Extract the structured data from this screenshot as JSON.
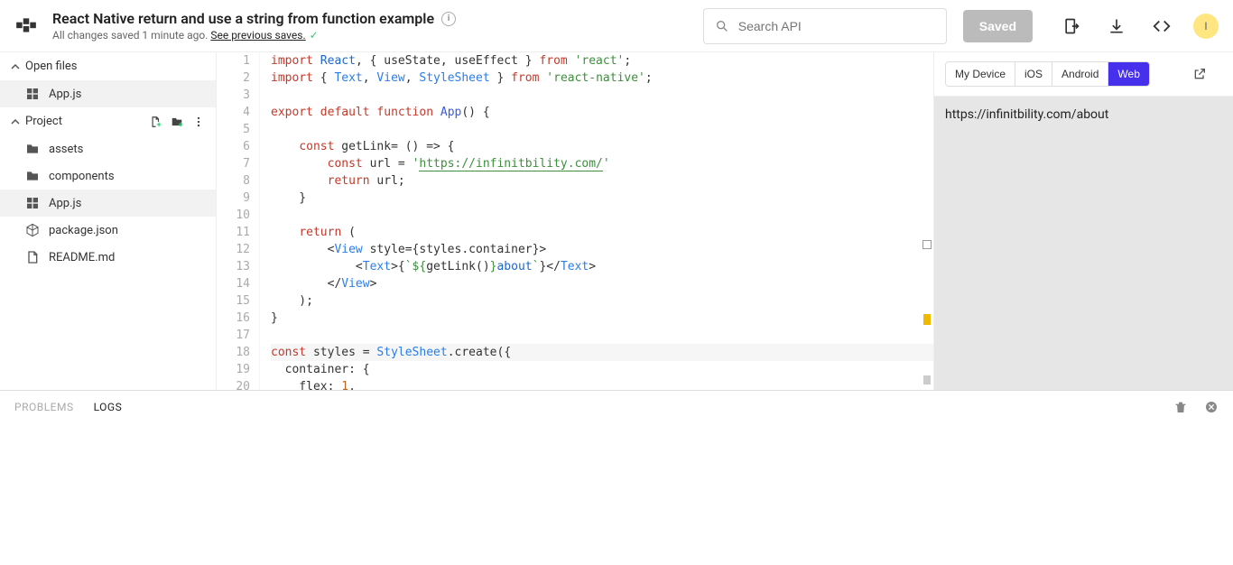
{
  "header": {
    "title": "React Native return and use a string from function example",
    "subtitle_prefix": "All changes saved 1 minute ago. ",
    "subtitle_link": "See previous saves.",
    "search_placeholder": "Search API",
    "saved_label": "Saved",
    "avatar_letter": "I"
  },
  "sidebar": {
    "open_files_label": "Open files",
    "open_files": [
      {
        "name": "App.js",
        "icon": "js-icon"
      }
    ],
    "project_label": "Project",
    "project_items": [
      {
        "name": "assets",
        "icon": "folder-icon"
      },
      {
        "name": "components",
        "icon": "folder-icon"
      },
      {
        "name": "App.js",
        "icon": "js-icon",
        "active": true
      },
      {
        "name": "package.json",
        "icon": "package-icon"
      },
      {
        "name": "README.md",
        "icon": "md-icon"
      }
    ]
  },
  "editor": {
    "line_count": 20,
    "lines": [
      {
        "n": 1,
        "html": "<span class='tok-kw'>import</span> <span class='tok-def'>React</span>, { useState, useEffect } <span class='tok-kw'>from</span> <span class='tok-str'>'react'</span>;"
      },
      {
        "n": 2,
        "html": "<span class='tok-kw'>import</span> { <span class='tok-cls'>Text</span>, <span class='tok-cls'>View</span>, <span class='tok-cls'>StyleSheet</span> } <span class='tok-kw'>from</span> <span class='tok-str'>'react-native'</span>;"
      },
      {
        "n": 3,
        "html": ""
      },
      {
        "n": 4,
        "html": "<span class='tok-kw'>export</span> <span class='tok-kw'>default</span> <span class='tok-kw'>function</span> <span class='tok-fn'>App</span>() {"
      },
      {
        "n": 5,
        "html": ""
      },
      {
        "n": 6,
        "html": "    <span class='tok-kw'>const</span> getLink= () => {"
      },
      {
        "n": 7,
        "html": "        <span class='tok-kw'>const</span> url = <span class='tok-str'>'</span><span class='tok-url'>https://infinitbility.com/</span><span class='tok-str'>'</span>"
      },
      {
        "n": 8,
        "html": "        <span class='tok-kw'>return</span> url;"
      },
      {
        "n": 9,
        "html": "    }"
      },
      {
        "n": 10,
        "html": ""
      },
      {
        "n": 11,
        "html": "    <span class='tok-kw'>return</span> ("
      },
      {
        "n": 12,
        "html": "        &lt;<span class='tok-cls'>View</span> style={styles.container}&gt;"
      },
      {
        "n": 13,
        "html": "            &lt;<span class='tok-cls'>Text</span>&gt;{<span class='tok-str'>`${</span>getLink()<span class='tok-str'>}</span><span class='tok-def'>about</span><span class='tok-str'>`</span>}&lt;/<span class='tok-cls'>Text</span>&gt;"
      },
      {
        "n": 14,
        "html": "        &lt;/<span class='tok-cls'>View</span>&gt;"
      },
      {
        "n": 15,
        "html": "    );"
      },
      {
        "n": 16,
        "html": "}"
      },
      {
        "n": 17,
        "html": ""
      },
      {
        "n": 18,
        "html": "<span class='tok-kw'>const</span> styles = <span class='tok-cls'>StyleSheet</span>.create({",
        "hl": true
      },
      {
        "n": 19,
        "html": "  container: {"
      },
      {
        "n": 20,
        "html": "    flex: <span class='tok-num'>1</span>,"
      }
    ]
  },
  "preview": {
    "tabs": [
      "My Device",
      "iOS",
      "Android",
      "Web"
    ],
    "active_tab": "Web",
    "output_text": "https://infinitbility.com/about"
  },
  "console": {
    "tabs": [
      "PROBLEMS",
      "LOGS"
    ],
    "active_tab": "LOGS"
  }
}
